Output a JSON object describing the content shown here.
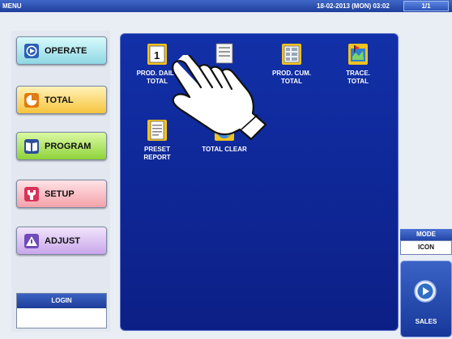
{
  "titlebar": {
    "screen": "MENU",
    "datetime": "18-02-2013 (MON) 03:02",
    "page": "1/1"
  },
  "left_menu": {
    "operate": "OPERATE",
    "total": "TOTAL",
    "program": "PROGRAM",
    "setup": "SETUP",
    "adjust": "ADJUST"
  },
  "login": {
    "label": "LOGIN",
    "value": ""
  },
  "icons": [
    {
      "line1": "PROD. DAILY",
      "line2": "TOTAL",
      "icon": "calendar-page-icon"
    },
    {
      "line1": "",
      "line2": "",
      "icon": "document-stack-icon"
    },
    {
      "line1": "PROD. CUM.",
      "line2": "TOTAL",
      "icon": "grid-document-icon"
    },
    {
      "line1": "TRACE.",
      "line2": "TOTAL",
      "icon": "trace-map-icon"
    },
    {
      "line1": "PRESET",
      "line2": "REPORT",
      "icon": "report-sheet-icon"
    },
    {
      "line1": "TOTAL CLEAR",
      "line2": "",
      "icon": "globe-clear-icon"
    }
  ],
  "mode": {
    "label": "MODE",
    "value": "ICON"
  },
  "sales": {
    "label": "SALES"
  },
  "colors": {
    "main_panel": "#1230a8",
    "titlebar": "#2a4fb0",
    "operate": "#8fd7e2",
    "total": "#f6c43d",
    "program": "#8fd33a",
    "setup": "#f3a2aa",
    "adjust": "#c9a6ea"
  }
}
